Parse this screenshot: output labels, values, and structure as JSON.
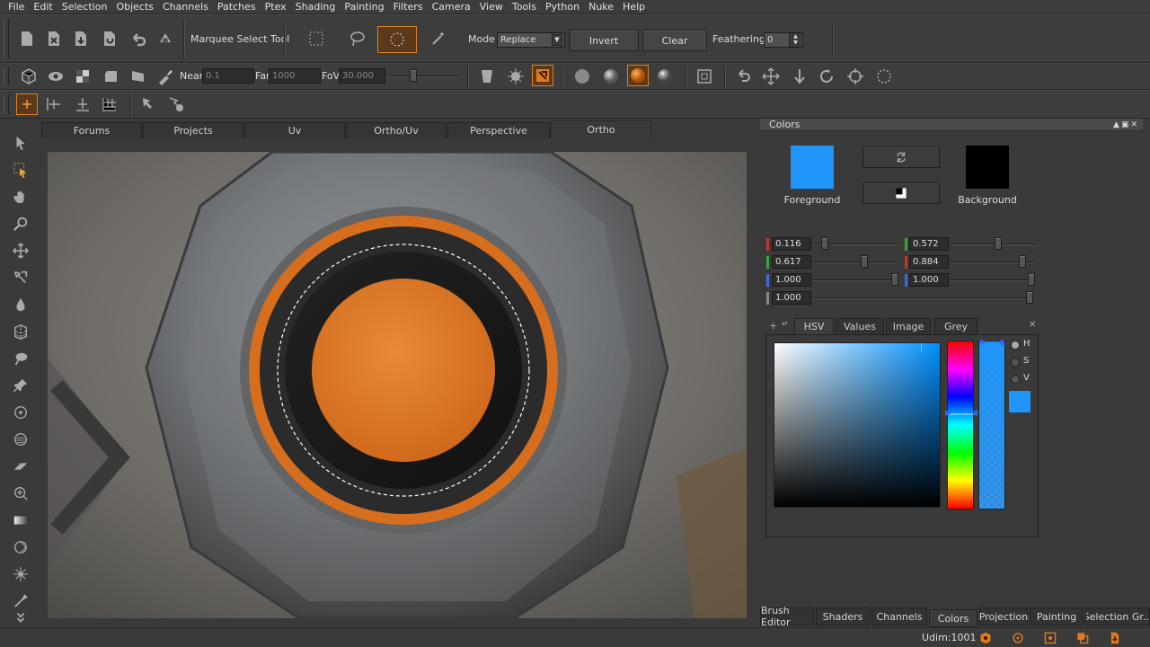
{
  "menu": [
    "File",
    "Edit",
    "Selection",
    "Objects",
    "Channels",
    "Patches",
    "Ptex",
    "Shading",
    "Painting",
    "Filters",
    "Camera",
    "View",
    "Tools",
    "Python",
    "Nuke",
    "Help"
  ],
  "toolbar1": {
    "tool_name": "Marquee Select Tool",
    "mode_label": "Mode",
    "mode_value": "Replace",
    "invert_label": "Invert",
    "clear_label": "Clear",
    "feathering_label": "Feathering",
    "feathering_value": "0"
  },
  "toolbar2": {
    "near_label": "Near",
    "near_value": "0.1",
    "far_label": "Far",
    "far_value": "1000",
    "fov_label": "FoV",
    "fov_value": "30.000"
  },
  "viewport_tabs": [
    "Forums",
    "Projects",
    "Uv",
    "Ortho/Uv",
    "Perspective",
    "Ortho"
  ],
  "active_viewport_tab": "Ortho",
  "colors_panel": {
    "title": "Colors",
    "foreground_label": "Foreground",
    "background_label": "Background",
    "foreground_color": "#1f95fa",
    "background_color": "#000000",
    "channels_left": [
      {
        "channel": "r",
        "value": "0.116",
        "fraction": 0.116,
        "color": "#c0392b"
      },
      {
        "channel": "g",
        "value": "0.617",
        "fraction": 0.617,
        "color": "#3aa43a"
      },
      {
        "channel": "b",
        "value": "1.000",
        "fraction": 1.0,
        "color": "#3a6fd8"
      },
      {
        "channel": "a",
        "value": "1.000",
        "fraction": 1.0,
        "color": "#888888"
      }
    ],
    "channels_right": [
      {
        "channel": "h",
        "value": "0.572",
        "fraction": 0.572,
        "color": "#3aa43a"
      },
      {
        "channel": "s",
        "value": "0.884",
        "fraction": 0.884,
        "color": "#c0392b"
      },
      {
        "channel": "v",
        "value": "1.000",
        "fraction": 1.0,
        "color": "#3a6fd8"
      }
    ],
    "picker_tabs": [
      "HSV",
      "Values",
      "Image",
      "Grey"
    ],
    "active_picker_tab": "HSV",
    "radio_labels": [
      "H",
      "S",
      "V"
    ],
    "selected_radio": "H"
  },
  "bottom_tabs": [
    "Brush Editor",
    "Shaders",
    "Channels",
    "Colors",
    "Projection",
    "Painting",
    "Selection Gr..."
  ],
  "active_bottom_tab": "Colors",
  "status": {
    "udim": "Udim:1001"
  },
  "accent_color": "#e07a1c"
}
